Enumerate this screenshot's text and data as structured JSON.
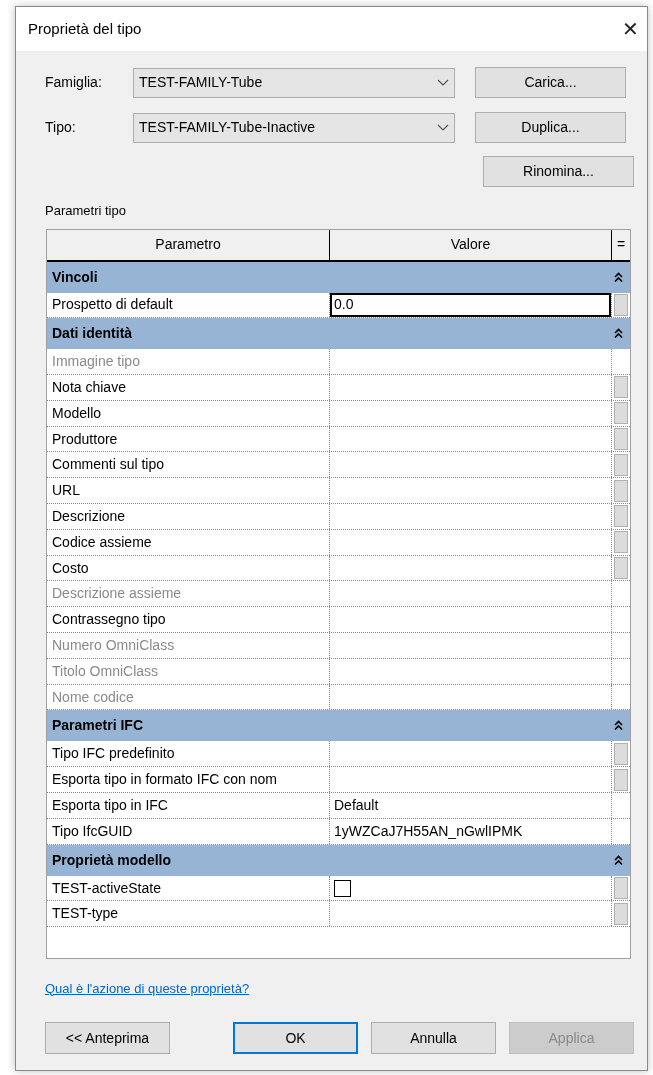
{
  "window": {
    "title": "Proprietà del tipo",
    "close": "✕"
  },
  "fields": [
    {
      "label": "Famiglia:",
      "value": "TEST-FAMILY-Tube",
      "button": "Carica..."
    },
    {
      "label": "Tipo:",
      "value": "TEST-FAMILY-Tube-Inactive",
      "button": "Duplica..."
    }
  ],
  "rename_button": "Rinomina...",
  "grid_label": "Parametri tipo",
  "columns": [
    "Parametro",
    "Valore",
    "="
  ],
  "groups": [
    {
      "title": "Vincoli",
      "expanded": true,
      "rows": [
        {
          "kind": "input",
          "label": "Prospetto di default",
          "value": "0.0",
          "disabled": false,
          "has_button": true
        }
      ]
    },
    {
      "title": "Dati identità",
      "expanded": true,
      "rows": [
        {
          "kind": "text",
          "label": "Immagine tipo",
          "disabled": true,
          "has_button": false
        },
        {
          "kind": "text",
          "label": "Nota chiave",
          "disabled": false,
          "has_button": true
        },
        {
          "kind": "text",
          "label": "Modello",
          "disabled": false,
          "has_button": true
        },
        {
          "kind": "text",
          "label": "Produttore",
          "disabled": false,
          "has_button": true
        },
        {
          "kind": "text",
          "label": "Commenti sul tipo",
          "disabled": false,
          "has_button": true
        },
        {
          "kind": "text",
          "label": "URL",
          "disabled": false,
          "has_button": true
        },
        {
          "kind": "text",
          "label": "Descrizione",
          "disabled": false,
          "has_button": true
        },
        {
          "kind": "text",
          "label": "Codice assieme",
          "disabled": false,
          "has_button": true
        },
        {
          "kind": "text",
          "label": "Costo",
          "disabled": false,
          "has_button": true
        },
        {
          "kind": "text",
          "label": "Descrizione assieme",
          "disabled": true,
          "has_button": false
        },
        {
          "kind": "text",
          "label": "Contrassegno tipo",
          "disabled": false,
          "has_button": false
        },
        {
          "kind": "text",
          "label": "Numero OmniClass",
          "disabled": true,
          "has_button": false
        },
        {
          "kind": "text",
          "label": "Titolo OmniClass",
          "disabled": true,
          "has_button": false
        },
        {
          "kind": "text",
          "label": "Nome codice",
          "disabled": true,
          "has_button": false
        }
      ]
    },
    {
      "title": "Parametri IFC",
      "expanded": true,
      "rows": [
        {
          "kind": "text",
          "label": "Tipo IFC predefinito",
          "disabled": false,
          "has_button": true
        },
        {
          "kind": "text",
          "label": "Esporta tipo in formato IFC con nom",
          "disabled": false,
          "has_button": true
        },
        {
          "kind": "text",
          "label": "Esporta tipo in IFC",
          "value": "Default",
          "disabled": false,
          "has_button": false
        },
        {
          "kind": "text",
          "label": "Tipo IfcGUID",
          "value": "1yWZCaJ7H55AN_nGwlIPMK",
          "disabled": false,
          "has_button": false
        }
      ]
    },
    {
      "title": "Proprietà modello",
      "expanded": true,
      "rows": [
        {
          "kind": "checkbox",
          "label": "TEST-activeState",
          "checked": false,
          "disabled": false,
          "has_button": true
        },
        {
          "kind": "text",
          "label": "TEST-type",
          "disabled": false,
          "has_button": true
        }
      ]
    }
  ],
  "help_link": "Qual è l'azione di queste proprietà?",
  "buttons": [
    {
      "label": "<< Anteprima",
      "default": false,
      "disabled": false
    },
    {
      "label": "OK",
      "default": true,
      "disabled": false
    },
    {
      "label": "Annulla",
      "default": false,
      "disabled": false
    },
    {
      "label": "Applica",
      "default": false,
      "disabled": true
    }
  ]
}
